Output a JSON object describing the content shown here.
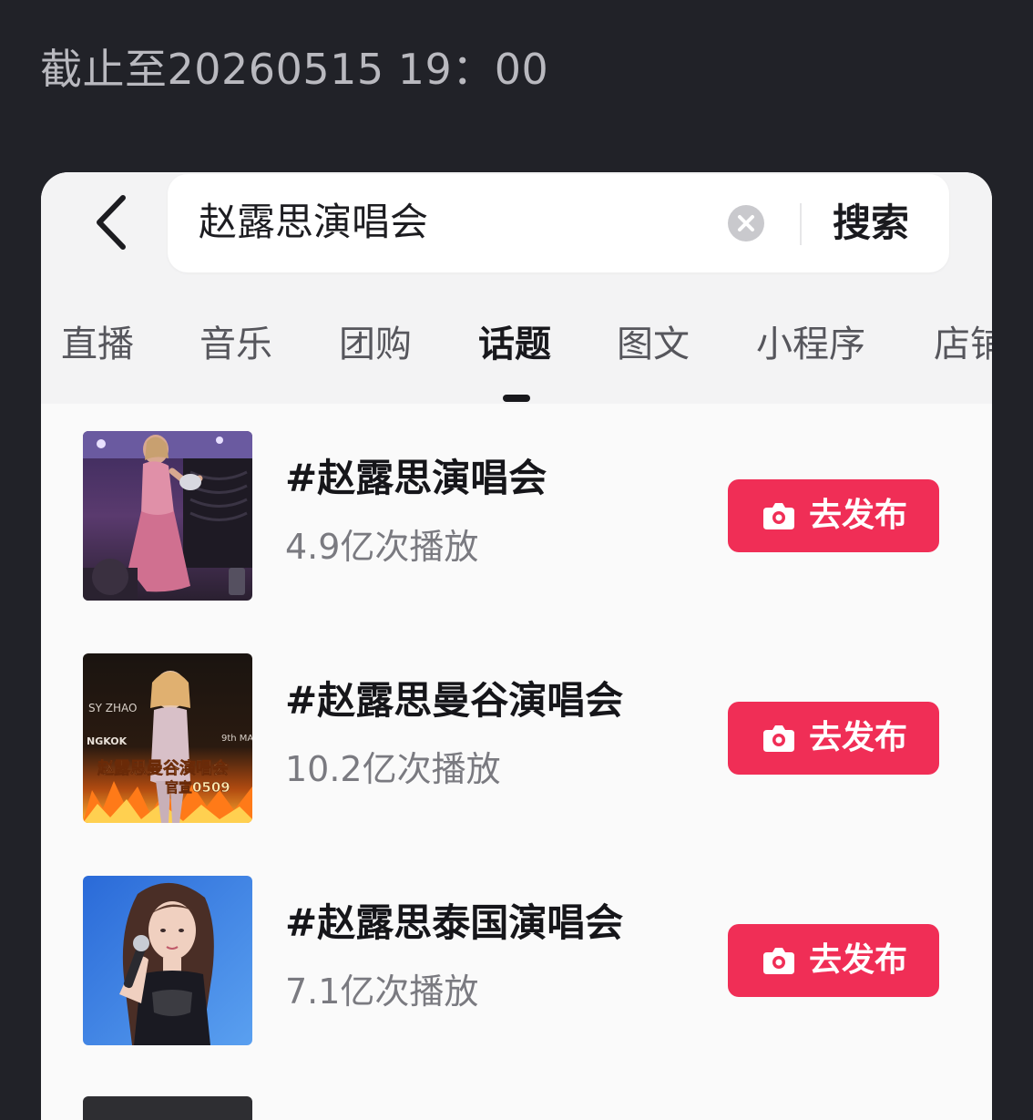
{
  "caption": "截止至20260515 19：00",
  "search": {
    "query": "赵露思演唱会",
    "button_label": "搜索"
  },
  "tabs": [
    {
      "label": "直播",
      "active": false
    },
    {
      "label": "音乐",
      "active": false
    },
    {
      "label": "团购",
      "active": false
    },
    {
      "label": "话题",
      "active": true
    },
    {
      "label": "图文",
      "active": false
    },
    {
      "label": "小程序",
      "active": false
    },
    {
      "label": "店铺",
      "active": false
    }
  ],
  "topics": [
    {
      "title": "#赵露思演唱会",
      "plays": "4.9亿次播放",
      "button_label": "去发布",
      "thumb": "stage-performance-photo"
    },
    {
      "title": "#赵露思曼谷演唱会",
      "plays": "10.2亿次播放",
      "button_label": "去发布",
      "thumb": "concert-poster",
      "poster_text": {
        "name": "SY ZHAO",
        "place": "NGKOK",
        "headline": "赵露思曼谷演唱会",
        "subline": "官宣0509",
        "date": "9th MA"
      }
    },
    {
      "title": "#赵露思泰国演唱会",
      "plays": "7.1亿次播放",
      "button_label": "去发布",
      "thumb": "singer-with-microphone-photo"
    }
  ],
  "icons": {
    "back": "chevron-left-icon",
    "clear": "clear-circle-icon",
    "publish": "camera-icon"
  },
  "colors": {
    "background_dark": "#212228",
    "accent_red": "#f02e56",
    "card": "#fafafa"
  }
}
